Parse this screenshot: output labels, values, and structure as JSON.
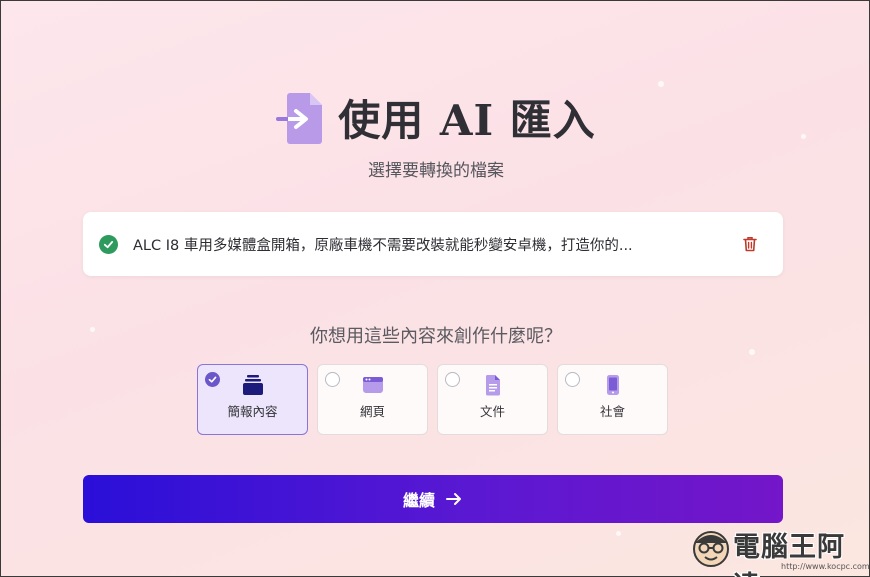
{
  "header": {
    "title": "使用 AI 匯入",
    "subtitle": "選擇要轉換的檔案",
    "icon": "file-import-icon"
  },
  "file": {
    "name": "ALC I8 車用多媒體盒開箱，原廠車機不需要改裝就能秒變安卓機，打造你的...",
    "status_icon": "check-circle-icon",
    "delete_icon": "trash-icon"
  },
  "question": "你想用這些內容來創作什麼呢？",
  "options": [
    {
      "label": "簡報內容",
      "icon": "presentation-stack-icon",
      "selected": true
    },
    {
      "label": "網頁",
      "icon": "webpage-icon",
      "selected": false
    },
    {
      "label": "文件",
      "icon": "document-icon",
      "selected": false
    },
    {
      "label": "社會",
      "icon": "phone-icon",
      "selected": false
    }
  ],
  "continue_label": "繼續",
  "watermark": {
    "text": "電腦王阿達",
    "url": "http://www.kocpc.com.tw"
  },
  "colors": {
    "accent": "#6b57c9",
    "button_start": "#2a0fd8",
    "button_end": "#7416c9",
    "success": "#2e9a5e",
    "danger": "#c0392b"
  }
}
